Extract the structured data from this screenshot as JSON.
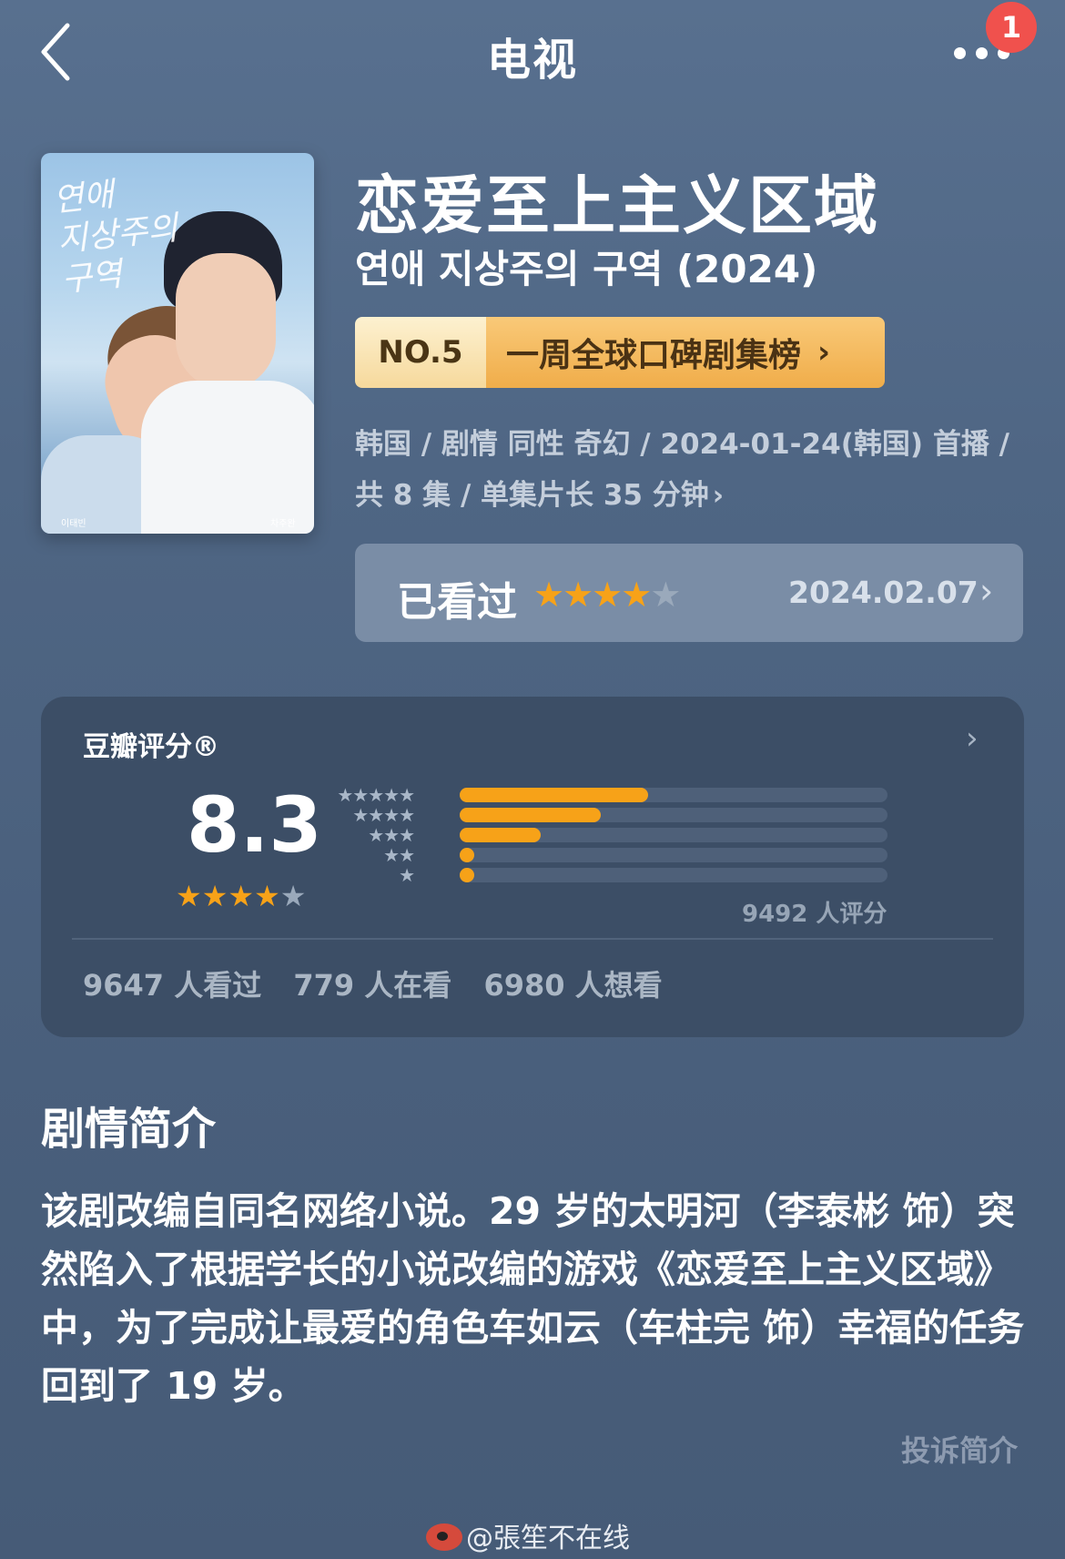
{
  "header": {
    "title": "电视",
    "notification_count": "1"
  },
  "poster": {
    "korean_title": "연애\n지상주의\n구역",
    "credit_left": "이태빈",
    "credit_right": "차주완"
  },
  "show": {
    "title": "恋爱至上主义区域",
    "original_title": "연애 지상주의 구역 (2024)",
    "rank_no": "NO.5",
    "rank_label": "一周全球口碑剧集榜",
    "meta_line1": "韩国 / 剧情 同性 奇幻 / 2024-01-24(韩国) 首播 /",
    "meta_line2": "共 8 集 / 单集片长 35 分钟"
  },
  "watched": {
    "label": "已看过",
    "my_rating_stars": 4,
    "date": "2024.02.07"
  },
  "rating": {
    "title": "豆瓣评分®",
    "score": "8.3",
    "score_stars": 4,
    "distribution": [
      {
        "stars": 5,
        "fraction": 0.44
      },
      {
        "stars": 4,
        "fraction": 0.33
      },
      {
        "stars": 3,
        "fraction": 0.19
      },
      {
        "stars": 2,
        "fraction": 0.03
      },
      {
        "stars": 1,
        "fraction": 0.03
      }
    ],
    "raters": "9492 人评分",
    "watched_count": "9647 人看过",
    "watching_count": "779 人在看",
    "want_count": "6980 人想看"
  },
  "synopsis": {
    "title": "剧情简介",
    "text": "该剧改编自同名网络小说。29 岁的太明河（李泰彬 饰）突然陷入了根据学长的小说改编的游戏《恋爱至上主义区域》中，为了完成让最爱的角色车如云（车柱完 饰）幸福的任务回到了 19 岁。",
    "complain_label": "投诉简介"
  },
  "watermark": "@張笙不在线",
  "colors": {
    "accent_orange": "#f7a218",
    "badge_red": "#f0514d",
    "background": "#4f6684",
    "card": "#3c4e66"
  }
}
